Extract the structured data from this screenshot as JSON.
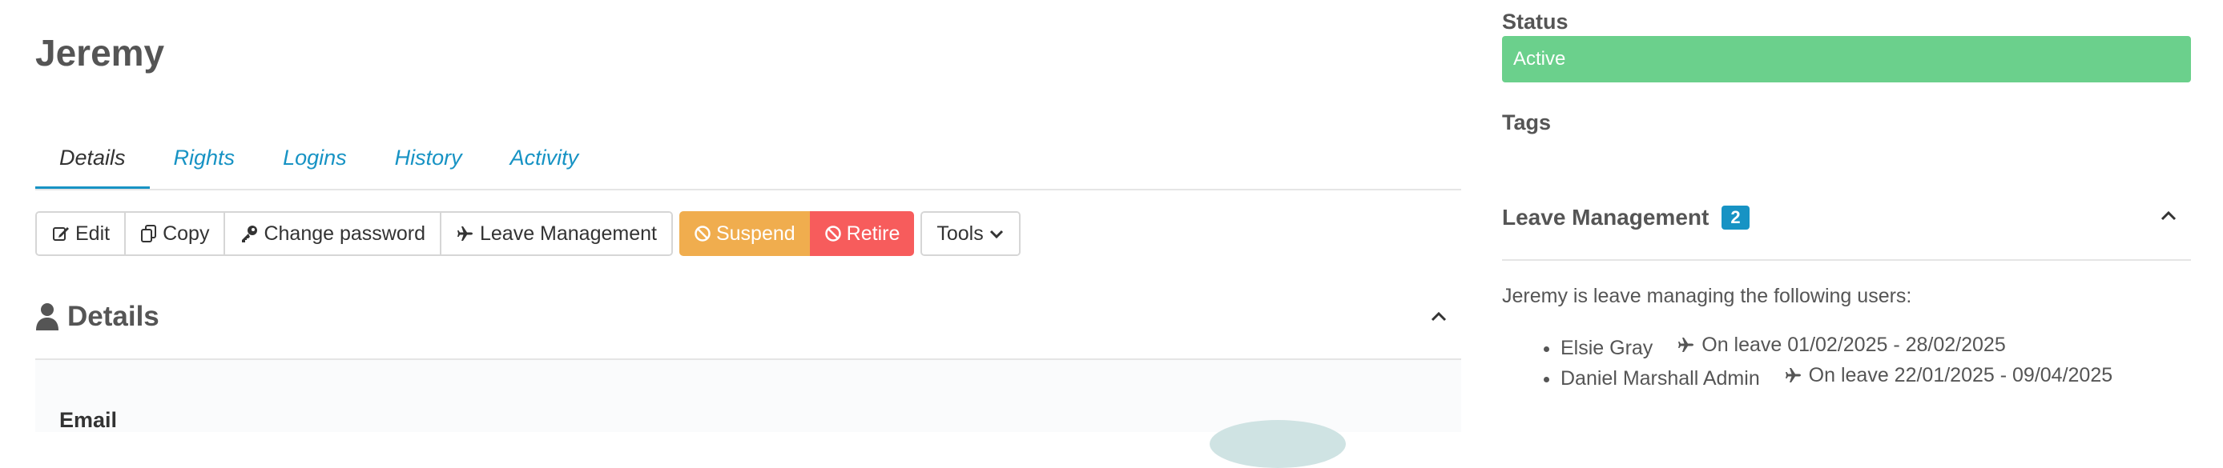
{
  "user": {
    "name": "Jeremy"
  },
  "tabs": [
    {
      "label": "Details",
      "active": true
    },
    {
      "label": "Rights",
      "active": false
    },
    {
      "label": "Logins",
      "active": false
    },
    {
      "label": "History",
      "active": false
    },
    {
      "label": "Activity",
      "active": false
    }
  ],
  "toolbar": {
    "edit_label": "Edit",
    "copy_label": "Copy",
    "change_password_label": "Change password",
    "leave_management_label": "Leave Management",
    "suspend_label": "Suspend",
    "retire_label": "Retire",
    "tools_label": "Tools"
  },
  "details": {
    "title": "Details",
    "email_label": "Email"
  },
  "status": {
    "label": "Status",
    "value": "Active",
    "color": "#6bd08c"
  },
  "tags": {
    "label": "Tags"
  },
  "leave_management": {
    "title": "Leave Management",
    "count": "2",
    "intro": "Jeremy is leave managing the following users:",
    "users": [
      {
        "name": "Elsie Gray",
        "leave": "On leave 01/02/2025 - 28/02/2025"
      },
      {
        "name": "Daniel Marshall Admin",
        "leave": "On leave 22/01/2025 - 09/04/2025"
      }
    ]
  },
  "colors": {
    "accent": "#1793c4",
    "suspend": "#f0ad4e",
    "retire": "#f75c5c"
  }
}
